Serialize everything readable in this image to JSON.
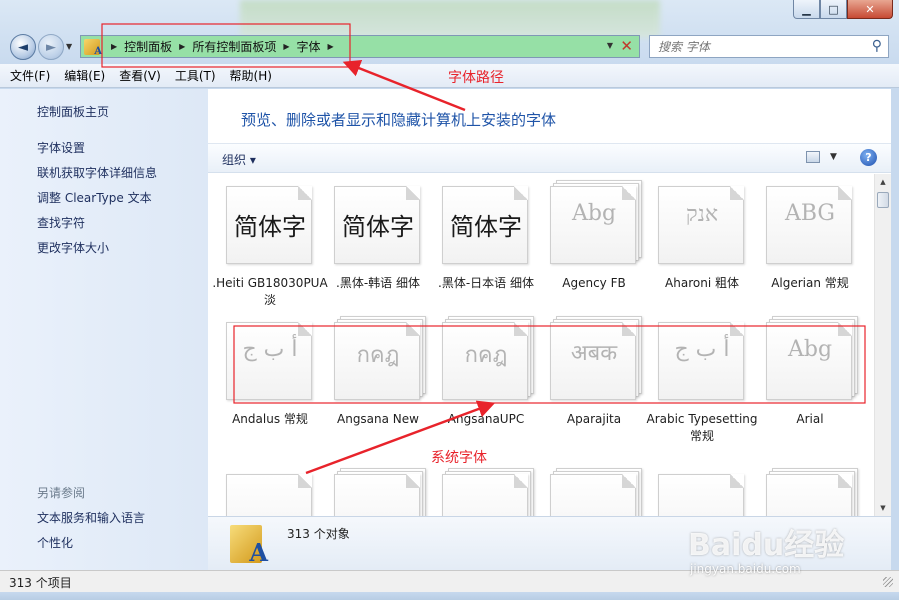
{
  "window": {
    "min_label": "▁",
    "max_label": "□",
    "close_label": "✕"
  },
  "address": {
    "crumbs": [
      "控制面板",
      "所有控制面板项",
      "字体"
    ],
    "back_label": "◄",
    "forward_label": "►"
  },
  "search": {
    "placeholder": "搜索 字体"
  },
  "menu": [
    "文件(F)",
    "编辑(E)",
    "查看(V)",
    "工具(T)",
    "帮助(H)"
  ],
  "sidebar": {
    "home": "控制面板主页",
    "tasks": [
      "字体设置",
      "联机获取字体详细信息",
      "调整 ClearType 文本",
      "查找字符",
      "更改字体大小"
    ],
    "see_also_title": "另请参阅",
    "see_also": [
      "文本服务和输入语言",
      "个性化"
    ]
  },
  "main": {
    "heading": "预览、删除或者显示和隐藏计算机上安装的字体",
    "organize": "组织",
    "help": "?"
  },
  "fonts": [
    {
      "label": ".Heiti GB18030PUA 淡",
      "glyph": "简体字",
      "style": "strong",
      "stack": 1
    },
    {
      "label": ".黑体-韩语 细体",
      "glyph": "简体字",
      "style": "strong",
      "stack": 1
    },
    {
      "label": ".黑体-日本语 细体",
      "glyph": "简体字",
      "style": "strong",
      "stack": 1
    },
    {
      "label": "Agency FB",
      "glyph": "Abg",
      "style": "faint",
      "stack": 3
    },
    {
      "label": "Aharoni 粗体",
      "glyph": "אנק",
      "style": "faint",
      "stack": 1
    },
    {
      "label": "Algerian 常规",
      "glyph": "ABG",
      "style": "faint",
      "stack": 1
    },
    {
      "label": "Andalus 常规",
      "glyph": "أ ب ج",
      "style": "faint",
      "stack": 1
    },
    {
      "label": "Angsana New",
      "glyph": "กคฎ",
      "style": "faint",
      "stack": 3
    },
    {
      "label": "AngsanaUPC",
      "glyph": "กคฎ",
      "style": "faint",
      "stack": 3
    },
    {
      "label": "Aparajita",
      "glyph": "अबक",
      "style": "faint",
      "stack": 3
    },
    {
      "label": "Arabic Typesetting 常规",
      "glyph": "أ ب ج",
      "style": "faint",
      "stack": 1
    },
    {
      "label": "Arial",
      "glyph": "Abg",
      "style": "faint",
      "stack": 3
    },
    {
      "label": "",
      "glyph": "",
      "style": "faint",
      "stack": 1
    },
    {
      "label": "",
      "glyph": "",
      "style": "faint",
      "stack": 3
    },
    {
      "label": "",
      "glyph": "",
      "style": "faint",
      "stack": 3
    },
    {
      "label": "",
      "glyph": "",
      "style": "faint",
      "stack": 3
    },
    {
      "label": "",
      "glyph": "",
      "style": "faint",
      "stack": 1
    },
    {
      "label": "",
      "glyph": "",
      "style": "faint",
      "stack": 3
    }
  ],
  "details": {
    "count": "313 个对象"
  },
  "status": {
    "text": "313 个项目"
  },
  "annotations": {
    "path_label": "字体路径",
    "system_label": "系统字体",
    "color": "#e8232b"
  },
  "watermark": {
    "logo": "Baidu经验",
    "url": "jingyan.baidu.com"
  }
}
